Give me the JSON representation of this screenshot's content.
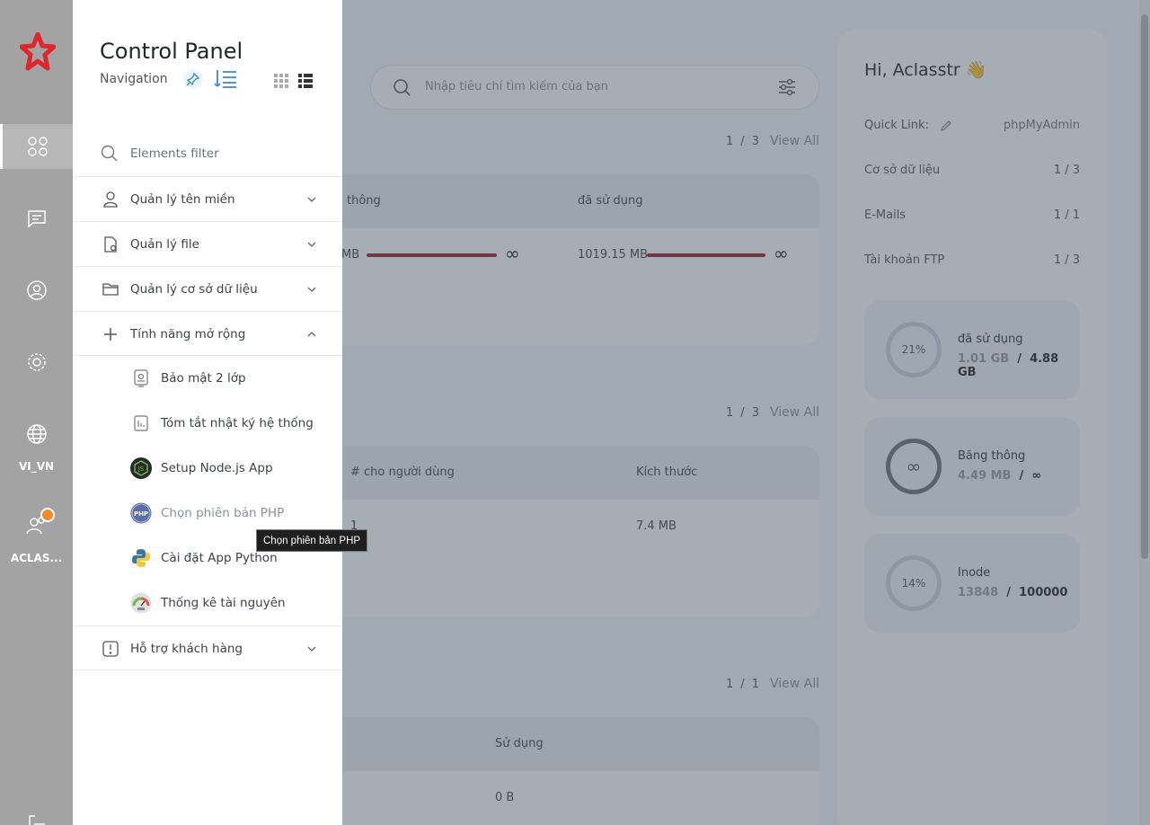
{
  "search": {
    "placeholder": "Nhập tiêu chí tìm kiếm của bạn"
  },
  "sections": [
    {
      "page": "1",
      "sep": "/",
      "total": "3",
      "view_all": "View All"
    },
    {
      "page": "1",
      "sep": "/",
      "total": "3",
      "view_all": "View All"
    },
    {
      "page": "1",
      "sep": "/",
      "total": "1",
      "view_all": "View All"
    }
  ],
  "card1": {
    "col1": "thông",
    "col2": "đã sử dụng",
    "val1": "MB",
    "val2": "1019.15 MB",
    "infinity": "∞"
  },
  "card2": {
    "col1": "# cho người dùng",
    "col2": "Kích thước",
    "val1": "1",
    "val2": "7.4 MB"
  },
  "card3": {
    "col1": "Sử dụng",
    "val1": "0 B"
  },
  "right_panel": {
    "greeting": "Hi, Aclasstr",
    "quick_link_label": "Quick Link:",
    "quick_link_value": "phpMyAdmin",
    "rows": [
      {
        "label": "Cơ sở dữ liệu",
        "value": "1 / 3"
      },
      {
        "label": "E-Mails",
        "value": "1 / 1"
      },
      {
        "label": "Tài khoản FTP",
        "value": "1 / 3"
      }
    ],
    "stats": [
      {
        "ring": "21%",
        "label": "đã sử dụng",
        "used": "1.01 GB",
        "sep": "/",
        "total": "4.88 GB"
      },
      {
        "ring": "∞",
        "label": "Băng thông",
        "used": "4.49 MB",
        "sep": "/",
        "total": "∞"
      },
      {
        "ring": "14%",
        "label": "Inode",
        "used": "13848",
        "sep": "/",
        "total": "100000"
      }
    ]
  },
  "rail": {
    "language": "VI_VN",
    "user": "ACLAS..."
  },
  "nav": {
    "title": "Control Panel",
    "subtitle": "Navigation",
    "filter_placeholder": "Elements filter",
    "items": [
      {
        "label": "Quản lý tên miền",
        "icon": "user-icon"
      },
      {
        "label": "Quản lý file",
        "icon": "file-icon"
      },
      {
        "label": "Quản lý cơ sở dữ liệu",
        "icon": "folder-icon"
      },
      {
        "label": "Tính năng mở rộng",
        "icon": "plus-icon"
      }
    ],
    "sub_items": [
      {
        "label": "Bảo mật 2 lớp"
      },
      {
        "label": "Tóm tắt nhật ký hệ thống"
      },
      {
        "label": "Setup Node.js App"
      },
      {
        "label": "Chọn phiên bản PHP"
      },
      {
        "label": "Cài đặt App Python"
      },
      {
        "label": "Thống kê tài nguyên"
      }
    ],
    "support": {
      "label": "Hỗ trợ khách hàng"
    }
  },
  "tooltip": "Chọn phiên bản PHP",
  "colors": {
    "accent_bar": "#a01c26",
    "rail": "#a3a3a3",
    "logo": "#e0262d",
    "badge": "#f08a2a"
  }
}
